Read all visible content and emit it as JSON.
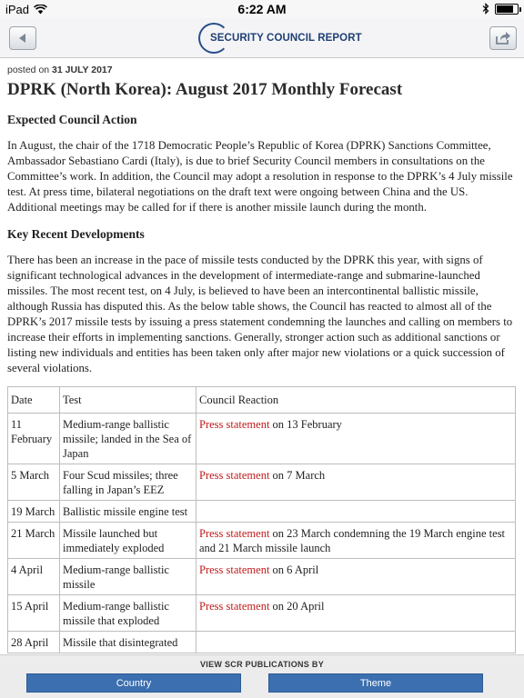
{
  "status_bar": {
    "device": "iPad",
    "time": "6:22 AM",
    "battery_level": 0.8
  },
  "nav": {
    "logo_text": "SECURITY COUNCIL REPORT"
  },
  "article": {
    "posted_prefix": "posted on",
    "posted_date": "31 JULY 2017",
    "title": "DPRK (North Korea): August 2017 Monthly Forecast",
    "sections": [
      {
        "heading": "Expected Council Action",
        "text": "In August, the chair of the 1718 Democratic People’s Republic of Korea (DPRK) Sanctions Committee, Ambassador Sebastiano Cardi (Italy), is due to brief Security Council members in consultations on the Committee’s work. In addition, the Council may adopt a resolution in response to the DPRK’s 4 July missile test. At press time, bilateral negotiations on the draft text were ongoing between China and the US. Additional meetings may be called for if there is another missile launch during the month."
      },
      {
        "heading": "Key Recent Developments",
        "text": "There has been an increase in the pace of missile tests conducted by the DPRK this year, with signs of significant technological advances in the development of intermediate-range and submarine-launched missiles. The most recent test, on 4 July, is believed to have been an intercontinental ballistic missile, although Russia has disputed this. As the below table shows, the Council has reacted to almost all of the DPRK’s 2017 missile tests by issuing a press statement condemning the launches and calling on members to increase their efforts in implementing sanctions. Generally, stronger action such as additional sanctions or listing new individuals and entities has been taken only after major new violations or a quick succession of several violations."
      }
    ]
  },
  "table": {
    "headers": [
      "Date",
      "Test",
      "Council Reaction"
    ],
    "rows": [
      {
        "date": "11 February",
        "test": "Medium-range ballistic missile; landed in the Sea of Japan",
        "link": "Press statement",
        "reaction": " on 13 February"
      },
      {
        "date": "5 March",
        "test": "Four Scud missiles; three falling in Japan’s EEZ",
        "link": "Press statement",
        "reaction": " on 7 March"
      },
      {
        "date": "19 March",
        "test": "Ballistic missile engine test",
        "link": "",
        "reaction": ""
      },
      {
        "date": "21 March",
        "test": "Missile launched but immediately exploded",
        "link": "Press statement",
        "reaction": " on 23 March condemning the 19 March engine test and 21 March missile launch"
      },
      {
        "date": "4 April",
        "test": "Medium-range ballistic missile",
        "link": "Press statement",
        "reaction": " on 6 April"
      },
      {
        "date": "15 April",
        "test": "Medium-range ballistic missile that exploded",
        "link": "Press statement",
        "reaction": " on 20 April"
      },
      {
        "date": "28 April",
        "test": "Missile that disintegrated",
        "link": "",
        "reaction": ""
      }
    ]
  },
  "bottom": {
    "title": "VIEW SCR PUBLICATIONS BY",
    "country_label": "Country",
    "theme_label": "Theme"
  }
}
